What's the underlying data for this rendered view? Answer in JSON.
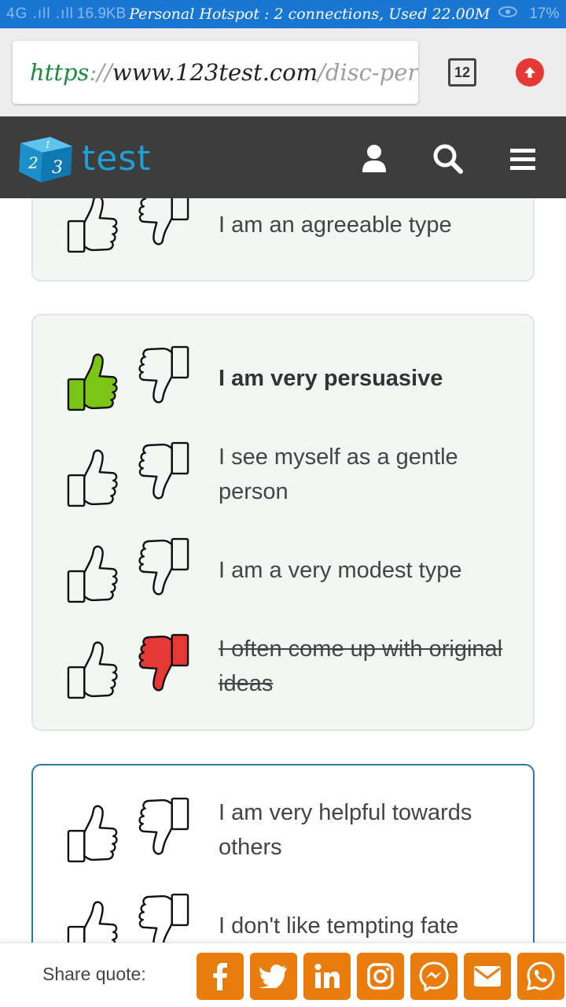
{
  "status_bar": {
    "signal": "4G .ıll .ıll",
    "speed": "16.9KB",
    "hotspot_text": "Personal Hotspot : 2 connections, Used 22.00M",
    "battery_percent": "17%",
    "bar_color": "#1976d2"
  },
  "browser": {
    "url_scheme": "https",
    "url_sep": "://",
    "url_host": "www.123test.com",
    "url_path": "/disc-per",
    "tab_count": "12"
  },
  "site": {
    "logo_text": "test",
    "logo_digits": [
      "1",
      "2",
      "3"
    ],
    "header_color": "#3d3d3d",
    "accent": "#1f9fd4",
    "icons": [
      "user-icon",
      "search-icon",
      "hamburger-menu-icon"
    ]
  },
  "questions": [
    {
      "statements": [
        {
          "text": "I am an agreeable type",
          "state": "none"
        }
      ]
    },
    {
      "statements": [
        {
          "text": "I am very persuasive",
          "state": "most"
        },
        {
          "text": "I see myself as a gentle person",
          "state": "none"
        },
        {
          "text": "I am a very modest type",
          "state": "none"
        },
        {
          "text": "I often come up with original ideas",
          "state": "least"
        }
      ]
    },
    {
      "statements": [
        {
          "text": "I am very helpful towards others",
          "state": "none"
        },
        {
          "text": "I don't like tempting fate",
          "state": "none"
        }
      ]
    }
  ],
  "colors": {
    "thumb_up_selected": "#7cc516",
    "thumb_down_selected": "#e53935",
    "share_button": "#e87c0c"
  },
  "share": {
    "label": "Share quote:",
    "buttons": [
      "facebook-icon",
      "twitter-icon",
      "linkedin-icon",
      "instagram-icon",
      "messenger-icon",
      "email-icon",
      "whatsapp-icon"
    ]
  }
}
